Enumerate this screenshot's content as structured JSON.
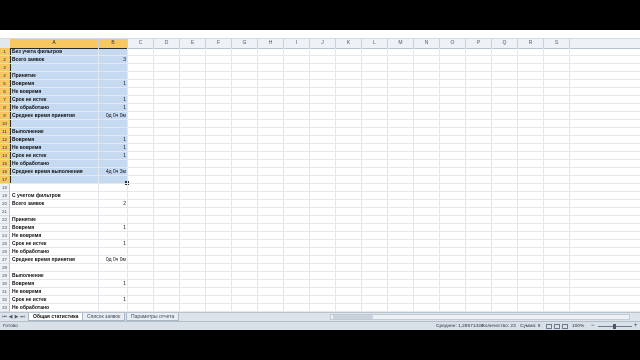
{
  "columns": [
    "A",
    "B",
    "C",
    "D",
    "E",
    "F",
    "G",
    "H",
    "I",
    "J",
    "K",
    "L",
    "M",
    "N",
    "O",
    "P",
    "Q",
    "R",
    "S"
  ],
  "rows": [
    {
      "n": "1",
      "a": "Без учета фильтров",
      "b": ""
    },
    {
      "n": "2",
      "a": "Всего заявок",
      "b": "3"
    },
    {
      "n": "3",
      "a": "",
      "b": ""
    },
    {
      "n": "4",
      "a": "Принятие",
      "b": ""
    },
    {
      "n": "5",
      "a": "Вовремя",
      "b": "1"
    },
    {
      "n": "6",
      "a": "Не вовремя",
      "b": ""
    },
    {
      "n": "7",
      "a": "Срок не истек",
      "b": "1"
    },
    {
      "n": "8",
      "a": "Не обработано",
      "b": "1"
    },
    {
      "n": "9",
      "a": "Среднее время принятия",
      "b": "0д 0ч 0м"
    },
    {
      "n": "10",
      "a": "",
      "b": ""
    },
    {
      "n": "11",
      "a": "Выполнение",
      "b": ""
    },
    {
      "n": "12",
      "a": "Вовремя",
      "b": "1"
    },
    {
      "n": "13",
      "a": "Не вовремя",
      "b": "1"
    },
    {
      "n": "14",
      "a": "Срок не истек",
      "b": "1"
    },
    {
      "n": "15",
      "a": "Не обработано",
      "b": ""
    },
    {
      "n": "16",
      "a": "Среднее время выполнения",
      "b": "4д 0ч 3м"
    },
    {
      "n": "17",
      "a": "",
      "b": ""
    },
    {
      "n": "18",
      "a": "",
      "b": ""
    },
    {
      "n": "19",
      "a": "С учетом фильтров",
      "b": ""
    },
    {
      "n": "20",
      "a": "Всего заявок",
      "b": "2"
    },
    {
      "n": "21",
      "a": "",
      "b": ""
    },
    {
      "n": "22",
      "a": "Принятие",
      "b": ""
    },
    {
      "n": "23",
      "a": "Вовремя",
      "b": "1"
    },
    {
      "n": "24",
      "a": "Не вовремя",
      "b": ""
    },
    {
      "n": "25",
      "a": "Срок не истек",
      "b": "1"
    },
    {
      "n": "26",
      "a": "Не обработано",
      "b": ""
    },
    {
      "n": "27",
      "a": "Среднее время принятия",
      "b": "0д 0ч 0м"
    },
    {
      "n": "28",
      "a": "",
      "b": ""
    },
    {
      "n": "29",
      "a": "Выполнение",
      "b": ""
    },
    {
      "n": "30",
      "a": "Вовремя",
      "b": "1"
    },
    {
      "n": "31",
      "a": "Не вовремя",
      "b": ""
    },
    {
      "n": "32",
      "a": "Срок не истек",
      "b": "1"
    },
    {
      "n": "33",
      "a": "Не обработано",
      "b": ""
    }
  ],
  "sheet_tabs": [
    "Общая статистика",
    "Список заявок",
    "Параметры отчета"
  ],
  "active_tab": "Общая статистика",
  "status": {
    "ready": "Готово",
    "average": "Среднее: 1,28571438",
    "count": "Количество: 23",
    "sum": "Сумма: 9",
    "zoom": "100%"
  },
  "colors": {
    "selection": "#c5d9f1",
    "header_highlight": "#f6c85f"
  }
}
